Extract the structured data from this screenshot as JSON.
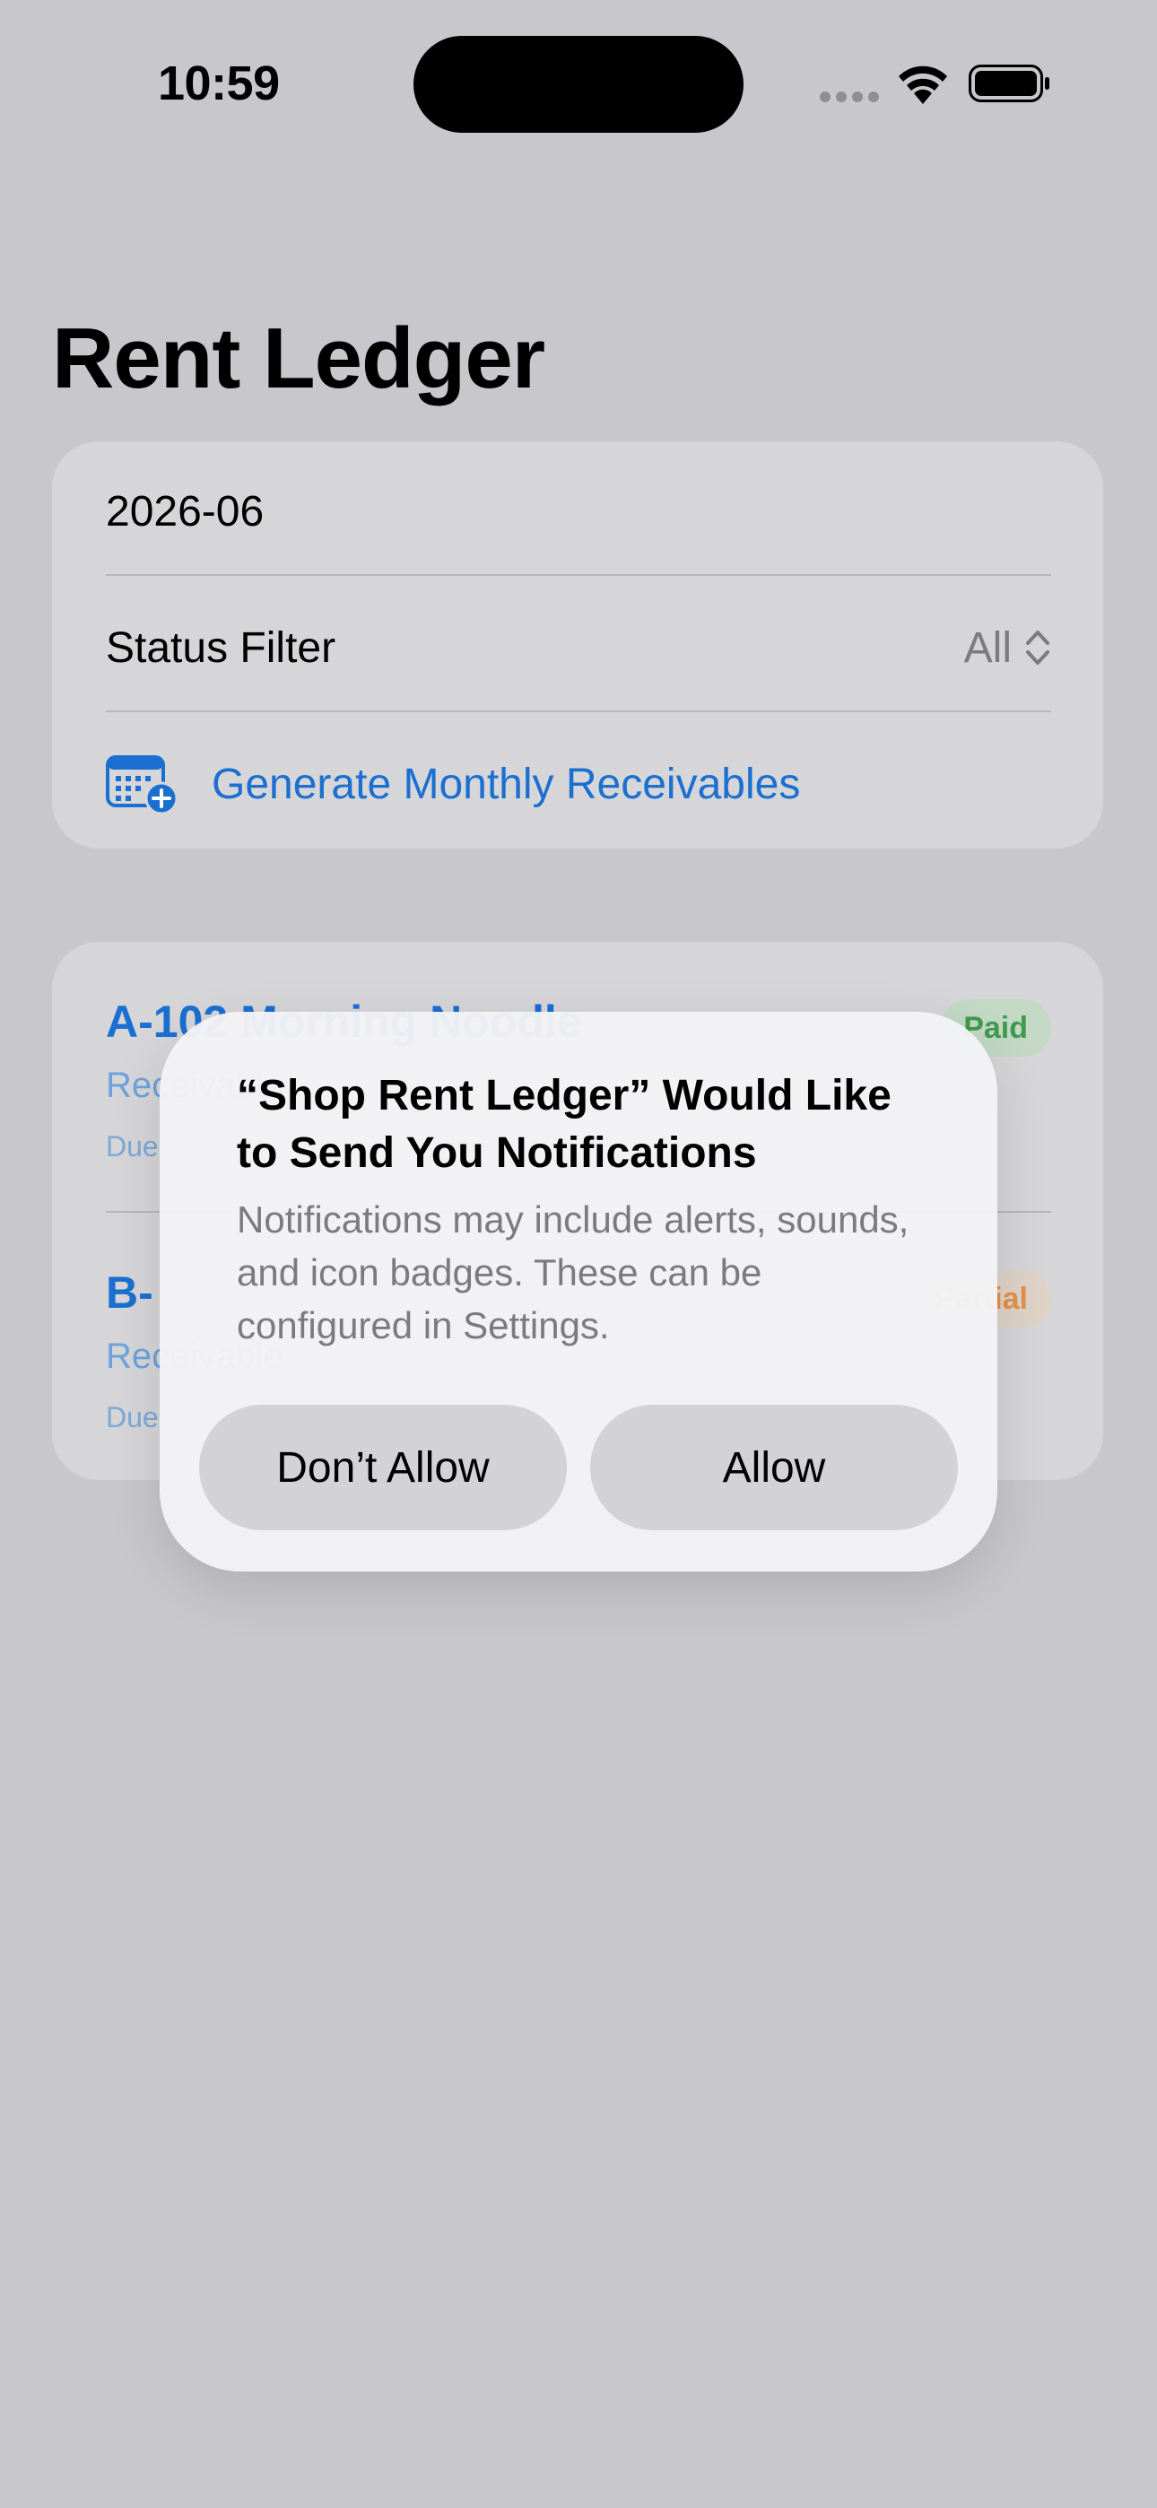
{
  "status_bar": {
    "time": "10:59",
    "icons": [
      "cellular-signal-icon",
      "wifi-icon",
      "battery-icon"
    ]
  },
  "header": {
    "title": "Rent Ledger"
  },
  "controls": {
    "month": "2026-06",
    "status_filter_label": "Status Filter",
    "status_filter_value": "All",
    "generate_label": "Generate Monthly Receivables",
    "generate_icon": "calendar-add-icon"
  },
  "list": {
    "items": [
      {
        "title": "A-102 Morning Noodle",
        "subtitle": "Receivable",
        "due": "Due",
        "status": "Paid"
      },
      {
        "title": "B-",
        "subtitle": "Receivable",
        "due": "Due",
        "status": "Partial"
      }
    ]
  },
  "alert": {
    "title": "“Shop Rent Ledger” Would Like to Send You Notifications",
    "message": "Notifications may include alerts, sounds, and icon badges. These can be configured in Settings.",
    "deny_label": "Don’t Allow",
    "allow_label": "Allow"
  },
  "colors": {
    "accent": "#1a6fd0",
    "paid": "#3f9a4c",
    "partial": "#e3904a",
    "background": "#c7c7cc"
  }
}
